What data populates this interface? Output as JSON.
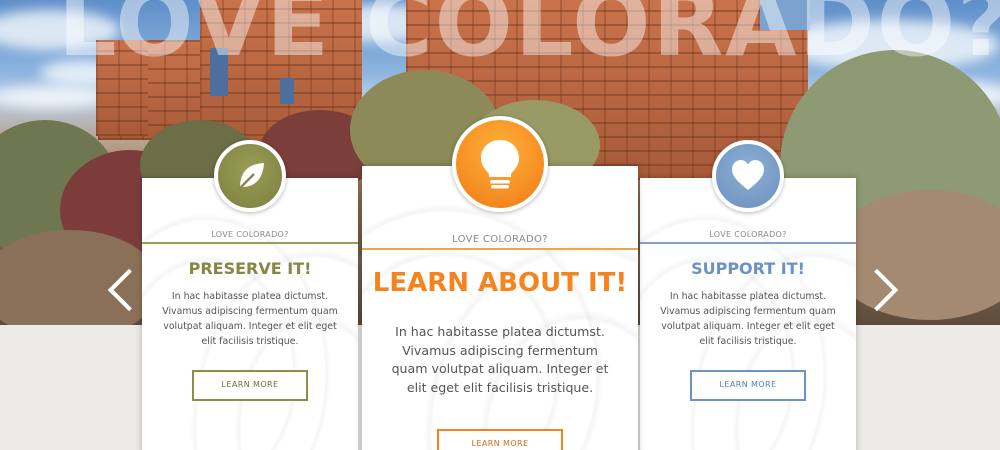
{
  "hero": {
    "headline": "LOVE COLORADO?"
  },
  "carousel": {
    "prev_icon": "chevron-left-icon",
    "next_icon": "chevron-right-icon"
  },
  "cards": [
    {
      "icon": "leaf-icon",
      "accent": "#8c8e4a",
      "kicker": "LOVE COLORADO?",
      "heading": "PRESERVE IT!",
      "body": "In hac habitasse platea dictumst. Vivamus adipiscing fermentum quam volutpat aliquam. Integer et elit eget elit facilisis tristique.",
      "button": "LEARN MORE"
    },
    {
      "icon": "lightbulb-icon",
      "accent": "#f5841f",
      "kicker": "LOVE COLORADO?",
      "heading": "LEARN ABOUT IT!",
      "body": "In hac habitasse platea dictumst. Vivamus adipiscing fermentum quam volutpat aliquam. Integer et elit eget elit facilisis tristique.",
      "button": "LEARN MORE"
    },
    {
      "icon": "heart-icon",
      "accent": "#6c94c2",
      "kicker": "LOVE COLORADO?",
      "heading": "SUPPORT IT!",
      "body": "In hac habitasse platea dictumst. Vivamus adipiscing fermentum quam volutpat aliquam. Integer et elit eget elit facilisis tristique.",
      "button": "LEARN MORE"
    }
  ]
}
